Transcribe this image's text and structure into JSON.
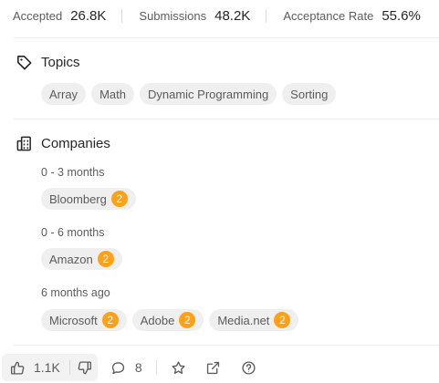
{
  "stats": [
    {
      "label": "Accepted",
      "value": "26.8K"
    },
    {
      "label": "Submissions",
      "value": "48.2K"
    },
    {
      "label": "Acceptance Rate",
      "value": "55.6%"
    }
  ],
  "topics": {
    "title": "Topics",
    "icon": "tag-icon",
    "tags": [
      "Array",
      "Math",
      "Dynamic Programming",
      "Sorting"
    ]
  },
  "companies": {
    "title": "Companies",
    "icon": "building-icon",
    "groups": [
      {
        "period": "0 - 3 months",
        "items": [
          {
            "name": "Bloomberg",
            "count": "2"
          }
        ]
      },
      {
        "period": "0 - 6 months",
        "items": [
          {
            "name": "Amazon",
            "count": "2"
          }
        ]
      },
      {
        "period": "6 months ago",
        "items": [
          {
            "name": "Microsoft",
            "count": "2"
          },
          {
            "name": "Adobe",
            "count": "2"
          },
          {
            "name": "Media.net",
            "count": "2"
          }
        ]
      }
    ]
  },
  "toolbar": {
    "likes": "1.1K",
    "comments": "8"
  },
  "colors": {
    "badge": "#ffa116",
    "tag_bg": "#efefef"
  }
}
